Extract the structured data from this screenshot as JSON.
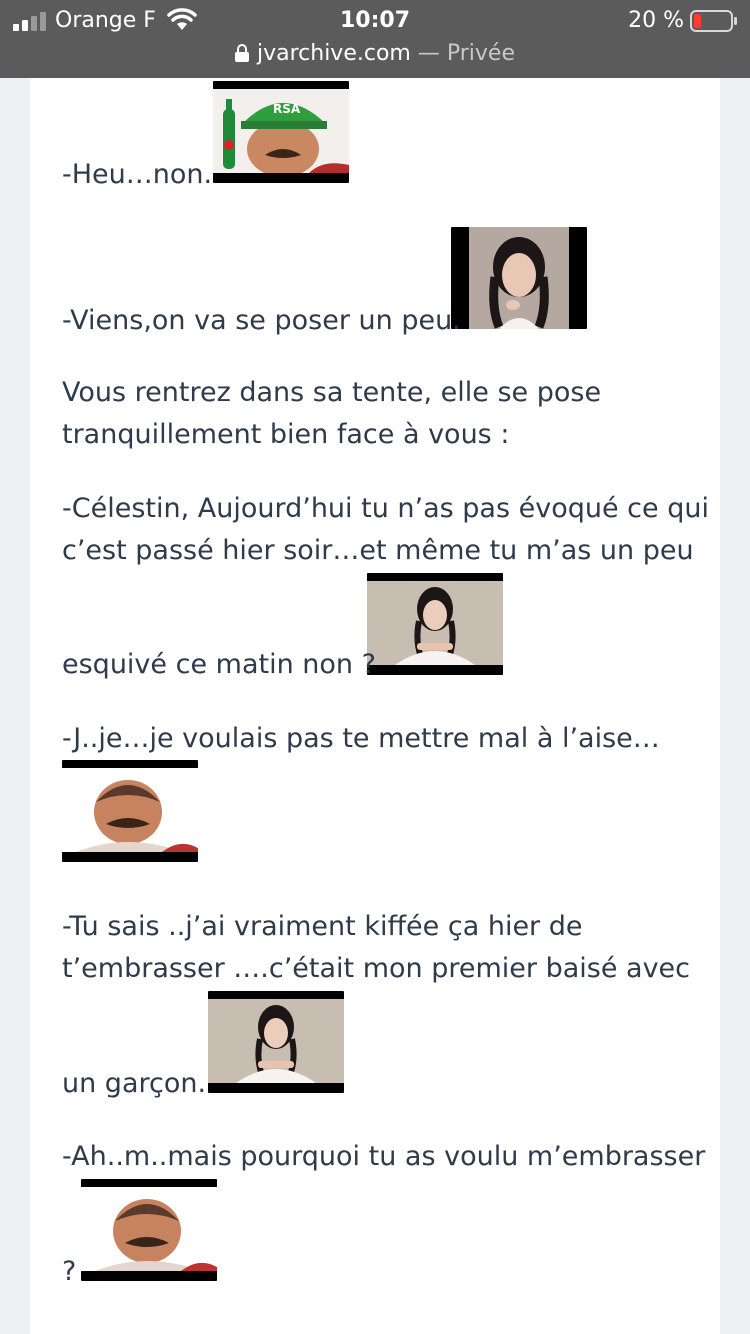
{
  "status_bar": {
    "carrier": "Orange F",
    "time": "10:07",
    "battery_percent": "20 %",
    "battery_level": 0.2
  },
  "url_bar": {
    "domain": "jvarchive.com",
    "separator": " — ",
    "mode": "Privée"
  },
  "post": {
    "lines": [
      "-Heu…non.",
      "-Viens,on va se poser un peu.",
      "Vous rentrez dans sa tente, elle se pose",
      "tranquillement bien face à vous :",
      "-Célestin, Aujourd’hui tu n’as pas évoqué ce qui",
      "c’est passé hier soir…et même tu m’as un peu",
      "esquivé ce matin non ?",
      "-J..je…je voulais pas te mettre mal à l’aise…",
      "-Tu sais ..j’ai vraiment kiffée ça hier de",
      "t’embrasser ….c’était mon premier baisé avec",
      "un garçon.",
      "-Ah..m..mais pourquoi tu as voulu m’embrasser",
      "?"
    ],
    "stickers": [
      {
        "icon": "risitas-cap-beer-sticker",
        "label": "RSA"
      },
      {
        "icon": "girl-braids-portrait-sticker"
      },
      {
        "icon": "girl-braids-hands-sticker"
      },
      {
        "icon": "risitas-laughing-sticker"
      },
      {
        "icon": "girl-braids-hands-sticker"
      },
      {
        "icon": "risitas-laughing-sticker"
      }
    ]
  }
}
